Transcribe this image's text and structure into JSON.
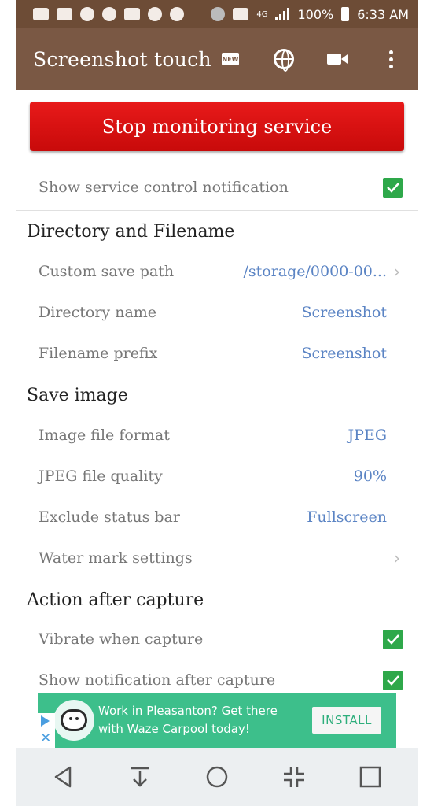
{
  "status_bar": {
    "battery_percent": "100%",
    "time": "6:33 AM",
    "network": "4G"
  },
  "app_bar": {
    "title": "Screenshot touch",
    "new_badge": "NEW"
  },
  "stop_button": {
    "label": "Stop monitoring service"
  },
  "service_notification": {
    "label": "Show service control notification",
    "checked": true
  },
  "sections": {
    "directory": "Directory and Filename",
    "save_image": "Save image",
    "action": "Action after capture"
  },
  "settings": {
    "custom_save_path": {
      "label": "Custom save path",
      "value": "/storage/0000-00..."
    },
    "directory_name": {
      "label": "Directory name",
      "value": "Screenshot"
    },
    "filename_prefix": {
      "label": "Filename prefix",
      "value": "Screenshot"
    },
    "image_format": {
      "label": "Image file format",
      "value": "JPEG"
    },
    "jpeg_quality": {
      "label": "JPEG file quality",
      "value": "90%"
    },
    "exclude_status_bar": {
      "label": "Exclude status bar",
      "value": "Fullscreen"
    },
    "water_mark": {
      "label": "Water mark settings"
    },
    "vibrate": {
      "label": "Vibrate when capture",
      "checked": true
    },
    "show_notification": {
      "label": "Show notification after capture",
      "checked": true
    }
  },
  "ad": {
    "text": "Work in Pleasanton? Get there with Waze Carpool today!",
    "install_label": "INSTALL"
  },
  "colors": {
    "status_bar": "#6d4c36",
    "app_bar": "#7a5844",
    "stop_button": "#d81010",
    "checkbox": "#2ea84a",
    "value_text": "#5b84c4",
    "ad_background": "#3dbf8b"
  }
}
